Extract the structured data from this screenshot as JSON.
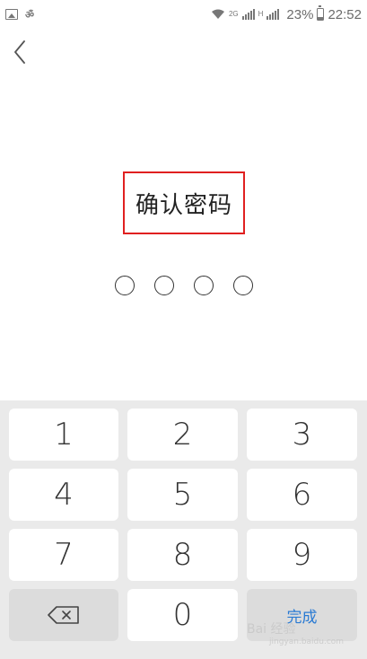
{
  "status_bar": {
    "time": "22:52",
    "battery": "23%",
    "network_label": "2G",
    "network_label_2": "H"
  },
  "header": {
    "back_icon": "chevron-left-icon"
  },
  "title": "确认密码",
  "pin": {
    "length": 4,
    "filled": 0
  },
  "keypad": {
    "keys": [
      "1",
      "2",
      "3",
      "4",
      "5",
      "6",
      "7",
      "8",
      "9"
    ],
    "zero": "0",
    "done_label": "完成",
    "backspace_icon": "backspace-icon"
  },
  "watermark": {
    "text": "Bai 经验",
    "sub": "jingyan.baidu.com"
  }
}
